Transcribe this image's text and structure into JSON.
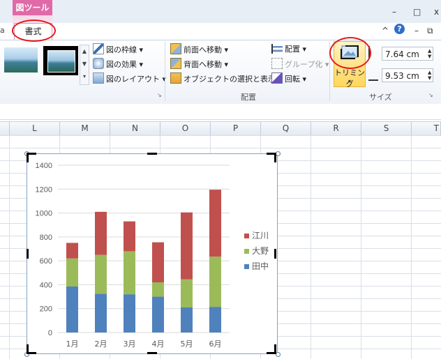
{
  "context_tab_group": "図ツール",
  "active_tab": "書式",
  "window_controls": {
    "minimize": "–",
    "restore": "□",
    "close": "x"
  },
  "ribbon_controls": {
    "collapse": "^",
    "help": "?",
    "minimize": "–",
    "restore": "⧉"
  },
  "picture_styles": {
    "border": "図の枠線",
    "effects": "図の効果",
    "layout": "図のレイアウト"
  },
  "arrange": {
    "bring_forward": "前面へ移動",
    "send_backward": "背面へ移動",
    "selection_pane": "オブジェクトの選択と表示",
    "align": "配置",
    "group": "グループ化",
    "rotate": "回転",
    "group_label": "配置"
  },
  "size": {
    "crop": "トリミング",
    "height": "7.64 cm",
    "width": "9.53 cm",
    "group_label": "サイズ"
  },
  "columns": [
    "L",
    "M",
    "N",
    "O",
    "P",
    "Q",
    "R",
    "S",
    "T"
  ],
  "colors": {
    "tanaka": "#4f81bd",
    "ono": "#9bbb59",
    "egawa": "#c0504d",
    "context_tab": "#e06aa8",
    "annotation": "#e51b1b"
  },
  "chart_data": {
    "type": "bar",
    "stacked": true,
    "categories": [
      "1月",
      "2月",
      "3月",
      "4月",
      "5月",
      "6月"
    ],
    "series": [
      {
        "name": "田中",
        "values": [
          385,
          325,
          320,
          300,
          210,
          215
        ]
      },
      {
        "name": "大野",
        "values": [
          235,
          325,
          360,
          120,
          235,
          420
        ]
      },
      {
        "name": "江川",
        "values": [
          130,
          360,
          250,
          335,
          560,
          560
        ]
      }
    ],
    "ylim": [
      0,
      1400
    ],
    "yticks": [
      "0",
      "200",
      "400",
      "600",
      "800",
      "1000",
      "1200",
      "1400"
    ],
    "legend": [
      "江川",
      "大野",
      "田中"
    ],
    "legend_position": "right",
    "grid": true
  }
}
